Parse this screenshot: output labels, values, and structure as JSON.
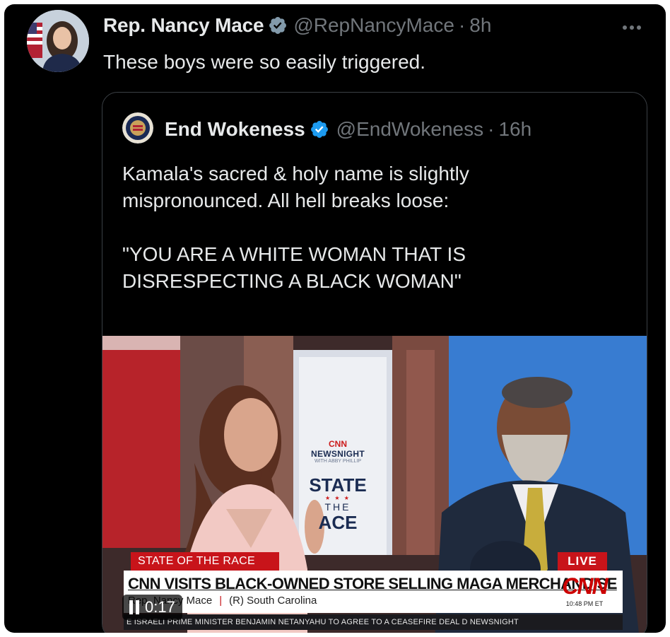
{
  "tweet": {
    "display_name": "Rep. Nancy Mace",
    "handle": "@RepNancyMace",
    "separator": "·",
    "time": "8h",
    "text": "These boys were so easily triggered.",
    "more_icon": "more-horizontal-icon"
  },
  "quoted_tweet": {
    "display_name": "End Wokeness",
    "handle": "@EndWokeness",
    "separator": "·",
    "time": "16h",
    "text_line_1": "Kamala's sacred & holy name is slightly",
    "text_line_2": "mispronounced. All hell breaks loose:",
    "text_line_3": "\"YOU ARE A WHITE WOMAN THAT IS",
    "text_line_4": "DISRESPECTING A BLACK WOMAN\""
  },
  "video": {
    "set_sign": {
      "logo": "CNN",
      "title": "NEWSNIGHT",
      "subtitle": "WITH ABBY PHILLIP",
      "word_1": "STATE",
      "word_2": "THE",
      "word_3": "ACE"
    },
    "chyron_tag": "STATE OF THE RACE",
    "live_tag": "LIVE",
    "headline": "CNN VISITS BLACK-OWNED STORE SELLING MAGA MERCHANDISE",
    "lower_third_name": "Rep. Nancy Mace",
    "lower_third_party": "(R) South Carolina",
    "network_logo": "CNN",
    "broadcast_time": "10:48 PM ET",
    "ticker": "E ISRAELI PRIME MINISTER BENJAMIN NETANYAHU TO AGREE TO A CEASEFIRE DEAL D NEWSNIGHT",
    "elapsed": "0:17"
  },
  "colors": {
    "background": "#000000",
    "text_primary": "#e7e9ea",
    "text_secondary": "#71767b",
    "verified_badge": "#1d9bf0",
    "border": "#3b4045",
    "cnn_red": "#cc0000"
  }
}
